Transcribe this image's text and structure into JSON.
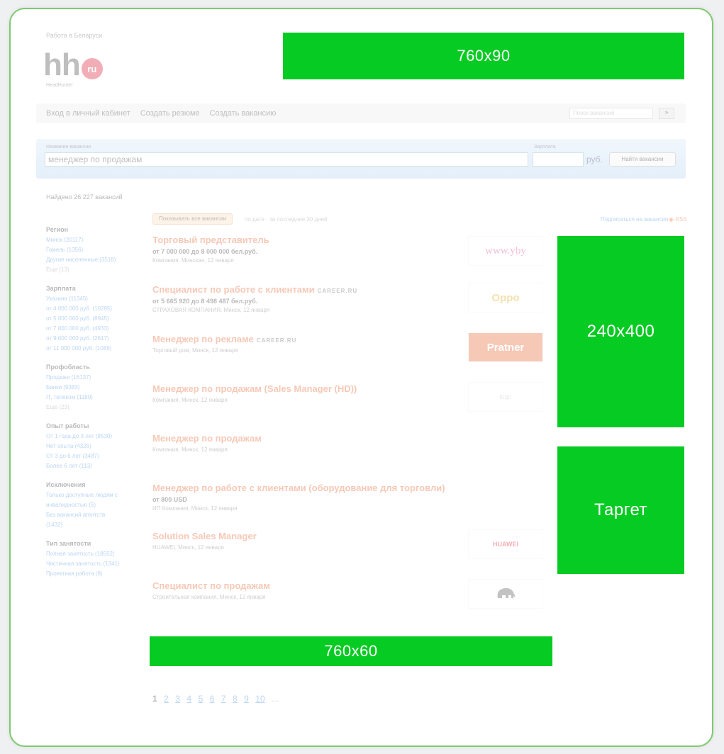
{
  "header": {
    "tagline": "Работа в Беларуси",
    "logo_main": "hh",
    "logo_ru": "ru",
    "logo_sub": "HeadHunter"
  },
  "nav": {
    "login": "Вход в личный кабинет",
    "create_resume": "Создать резюме",
    "create_vacancy": "Создать вакансию",
    "site_search_placeholder": "Поиск вакансий",
    "site_search_button": "»"
  },
  "search": {
    "label": "Название вакансии",
    "query": "менеджер по продажам",
    "salary_label": "Зарплата",
    "currency": "руб.",
    "button": "Найти вакансии"
  },
  "results_count": "Найдено 26 227 вакансий",
  "toolbar": {
    "filter_chip": "Показывать все вакансии",
    "sort_hint": "по дате · за последние 30 дней",
    "subscribe": "Подписаться на вакансии",
    "rss": "RSS"
  },
  "filters": [
    {
      "title": "Регион",
      "items": [
        "Минск (20117)",
        "Гомель (1356)",
        "Другие населенные (3518)",
        "Еще (13)"
      ]
    },
    {
      "title": "Зарплата",
      "items": [
        "Указана (11345)",
        "от 4 000 000 руб. (10295)",
        "от 5 000 000 руб. (8945)",
        "от 7 000 000 руб. (4933)",
        "от 9 000 000 руб. (2617)",
        "от 11 000 000 руб. (1088)"
      ]
    },
    {
      "title": "Профобласть",
      "items": [
        "Продажи (16137)",
        "Банки (9383)",
        "IT, телеком (1180)",
        "Еще (23)"
      ]
    },
    {
      "title": "Опыт работы",
      "items": [
        "От 1 года до 3 лет (9530)",
        "Нет опыта (4326)",
        "От 3 до 6 лет (3487)",
        "Более 6 лет (113)"
      ]
    },
    {
      "title": "Исключения",
      "items": [
        "Только доступные людям с инвалидностью (5)",
        "Без вакансий агентств (1432)"
      ]
    },
    {
      "title": "Тип занятости",
      "items": [
        "Полная занятость (18552)",
        "Частичная занятость (1341)",
        "Проектная работа (8)"
      ]
    }
  ],
  "vacancies": [
    {
      "title": "Торговый представитель",
      "career": "",
      "salary": "от 7 000 000 до 8 000 000 бел.руб.",
      "sub": "Компания, Минская, 12 января",
      "logo": "www.yby"
    },
    {
      "title": "Специалист по работе с клиентами",
      "career": "CAREER.RU",
      "salary": "от 5 665 920 до 8 498 487 бел.руб.",
      "sub": "СТРАХОВАЯ КОМПАНИЯ, Минск, 12 января",
      "logo": "Oppo"
    },
    {
      "title": "Менеджер по рекламе",
      "career": "CAREER.RU",
      "salary": "",
      "sub": "Торговый дом, Минск, 12 января",
      "logo": "Pratner"
    },
    {
      "title": "Менеджер по продажам (Sales Manager (HD))",
      "career": "",
      "salary": "",
      "sub": "Компания, Минск, 12 января",
      "logo": "logo"
    },
    {
      "title": "Менеджер по продажам",
      "career": "",
      "salary": "",
      "sub": "Компания, Минск, 12 января",
      "logo": ""
    },
    {
      "title": "Менеджер по работе с клиентами (оборудование для торговли)",
      "career": "",
      "salary": "от 800 USD",
      "sub": "ИП Компания, Минск, 12 января",
      "logo": ""
    },
    {
      "title": "Solution Sales Manager",
      "career": "",
      "salary": "",
      "sub": "HUAWEI, Минск, 12 января",
      "logo": "HUAWEI"
    },
    {
      "title": "Специалист по продажам",
      "career": "",
      "salary": "",
      "sub": "Строительная компания, Минск, 12 января",
      "logo": "elephant"
    }
  ],
  "pager": [
    "1",
    "2",
    "3",
    "4",
    "5",
    "6",
    "7",
    "8",
    "9",
    "10",
    "..."
  ],
  "ads": {
    "top": "760x90",
    "side": "240x400",
    "target": "Таргет",
    "bottom": "760x60"
  },
  "colors": {
    "ad_green": "#06cb22",
    "frame_green": "#7fc96f",
    "vacancy_orange": "#e2541c",
    "link_blue": "#2b7bd6"
  }
}
